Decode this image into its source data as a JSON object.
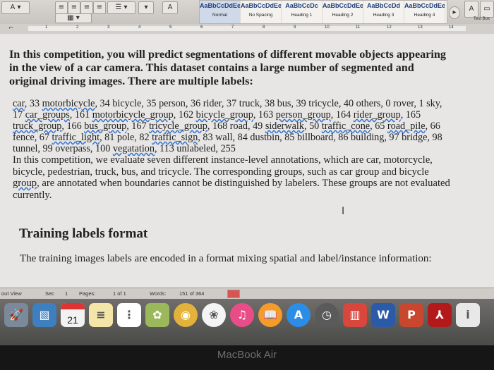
{
  "ribbon": {
    "styles": [
      {
        "preview": "AaBbCcDdEe",
        "name": "Normal",
        "active": true
      },
      {
        "preview": "AaBbCcDdEe",
        "name": "No Spacing",
        "active": false
      },
      {
        "preview": "AaBbCcDc",
        "name": "Heading 1",
        "active": false
      },
      {
        "preview": "AaBbCcDdEe",
        "name": "Heading 2",
        "active": false
      },
      {
        "preview": "AaBbCcDd",
        "name": "Heading 3",
        "active": false
      },
      {
        "preview": "AaBbCcDdEe",
        "name": "Heading 4",
        "active": false
      }
    ],
    "text_box_label": "Text Box"
  },
  "ruler": {
    "numbers": [
      "1",
      "2",
      "3",
      "4",
      "5",
      "6",
      "7",
      "8",
      "9",
      "10",
      "11",
      "12",
      "13",
      "14"
    ]
  },
  "document": {
    "intro": "In this competition, you will predict segmentations of different movable objects appearing in the view of a car camera. This dataset contains a large number of segmented and original driving images. There are multiple labels:",
    "labels_segments": [
      {
        "t": "car",
        "u": true
      },
      {
        "t": ", 33 ",
        "u": false
      },
      {
        "t": "motorbicycle",
        "u": true
      },
      {
        "t": ", 34 bicycle, 35 person, 36 rider, 37 truck, 38 bus, 39 tricycle, 40 others, 0 rover, 1 sky, 17 ",
        "u": false
      },
      {
        "t": "car_groups",
        "u": true
      },
      {
        "t": ", 161 ",
        "u": false
      },
      {
        "t": "motorbicycle_group",
        "u": true
      },
      {
        "t": ", 162 ",
        "u": false
      },
      {
        "t": "bicycle_group",
        "u": true
      },
      {
        "t": ", 163 ",
        "u": false
      },
      {
        "t": "person_group",
        "u": true
      },
      {
        "t": ", 164 ",
        "u": false
      },
      {
        "t": "rider_group",
        "u": true
      },
      {
        "t": ", 165 ",
        "u": false
      },
      {
        "t": "truck_group",
        "u": true
      },
      {
        "t": ", 166 ",
        "u": false
      },
      {
        "t": "bus_group",
        "u": true
      },
      {
        "t": ", 167 ",
        "u": false
      },
      {
        "t": "tricycle_group",
        "u": true
      },
      {
        "t": ", 168 road, 49 ",
        "u": false
      },
      {
        "t": "siderwalk",
        "u": true
      },
      {
        "t": ", 50 ",
        "u": false
      },
      {
        "t": "traffic_cone",
        "u": true
      },
      {
        "t": ", 65 ",
        "u": false
      },
      {
        "t": "road_pile",
        "u": true
      },
      {
        "t": ", 66 fence, 67 ",
        "u": false
      },
      {
        "t": "traffic_light",
        "u": true
      },
      {
        "t": ", 81 pole, 82 ",
        "u": false
      },
      {
        "t": "traffic_sign",
        "u": true
      },
      {
        "t": ", 83 wall, 84 dustbin, 85 billboard, 86 building, 97 bridge, 98 tunnel, 99 overpass, 100 ",
        "u": false
      },
      {
        "t": "vegatation",
        "u": true
      },
      {
        "t": ", 113 unlabeled, 255",
        "u": false
      }
    ],
    "evaluation_segments": [
      {
        "t": "In this competition, we evaluate seven different instance-level annotations, which are car, motorcycle, bicycle, pedestrian, truck, bus, and tricycle. The corresponding groups, such as car group and bicycle ",
        "u": false
      },
      {
        "t": "group",
        "u": true
      },
      {
        "t": ", are annotated when boundaries cannot be distinguished by labelers. These groups are not evaluated currently.",
        "u": false
      }
    ],
    "section_heading": "Training labels format",
    "training_text": "The training images labels are encoded in a format mixing spatial and label/instance information:"
  },
  "statusbar": {
    "view": "out View",
    "section_label": "Sec",
    "section_value": "1",
    "pages_label": "Pages:",
    "pages_value": "1 of 1",
    "words_label": "Words:",
    "words_value": "151 of 364"
  },
  "dock": {
    "calendar_day": "21",
    "icons": [
      {
        "name": "rocket-icon",
        "color": "#7a8a9a",
        "glyph": "🚀"
      },
      {
        "name": "preview-icon",
        "color": "#3e7fbf",
        "glyph": "▧"
      },
      {
        "name": "calendar-icon",
        "color": "#f2f2f2",
        "glyph": ""
      },
      {
        "name": "notes-icon",
        "color": "#f3e6a8",
        "glyph": "≡"
      },
      {
        "name": "reminders-icon",
        "color": "#ffffff",
        "glyph": "⋮"
      },
      {
        "name": "photo-booth-icon",
        "color": "#9bb85a",
        "glyph": "✿"
      },
      {
        "name": "chrome-icon",
        "color": "#e3b23c",
        "glyph": "◉"
      },
      {
        "name": "photos-icon",
        "color": "#f4f4f4",
        "glyph": "❀"
      },
      {
        "name": "itunes-icon",
        "color": "#e84d88",
        "glyph": "♫"
      },
      {
        "name": "ibooks-icon",
        "color": "#f49b2c",
        "glyph": "📖"
      },
      {
        "name": "app-store-icon",
        "color": "#2b8de6",
        "glyph": "A"
      },
      {
        "name": "time-machine-icon",
        "color": "#5a5a5a",
        "glyph": "◷"
      },
      {
        "name": "popcorn-icon",
        "color": "#d8463c",
        "glyph": "▥"
      },
      {
        "name": "word-icon",
        "color": "#2b5ba8",
        "glyph": "W"
      },
      {
        "name": "powerpoint-icon",
        "color": "#c9462f",
        "glyph": "P"
      },
      {
        "name": "acrobat-icon",
        "color": "#b3191b",
        "glyph": "⅄"
      },
      {
        "name": "file-icon",
        "color": "#e8e8e8",
        "glyph": "i"
      }
    ]
  },
  "device_label": "MacBook Air"
}
